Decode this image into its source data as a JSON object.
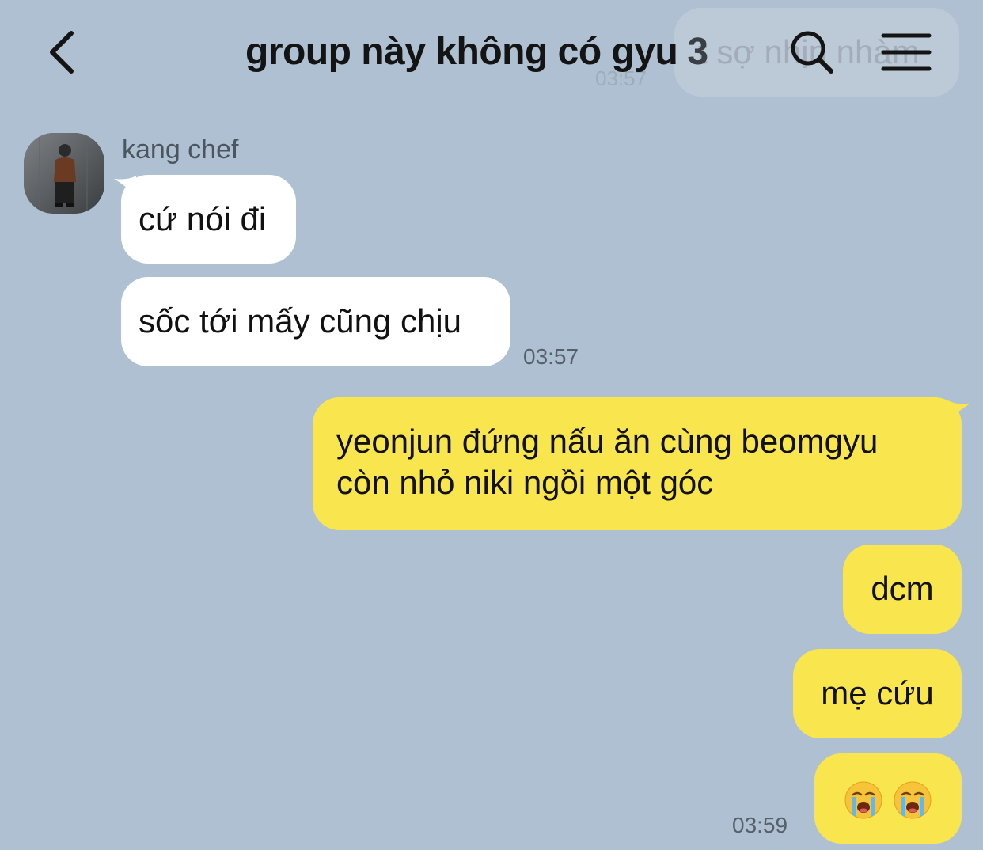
{
  "header": {
    "title": "group này không có gyu",
    "member_count": "3",
    "back_icon": "chevron-left-icon",
    "search_icon": "search-icon",
    "menu_icon": "menu-icon"
  },
  "overlay": {
    "text": "t sợ nhịn nhàm",
    "time": "03:57"
  },
  "messages": [
    {
      "direction": "incoming",
      "sender": "kang chef",
      "text": "cứ nói đi"
    },
    {
      "direction": "incoming",
      "text": "sốc tới mấy cũng chịu",
      "time": "03:57"
    },
    {
      "direction": "outgoing",
      "lines": [
        "yeonjun đứng nấu ăn cùng beomgyu",
        "còn nhỏ niki ngồi một góc"
      ]
    },
    {
      "direction": "outgoing",
      "text": "dcm"
    },
    {
      "direction": "outgoing",
      "text": "mẹ cứu"
    },
    {
      "direction": "outgoing",
      "text": "😭😭",
      "emoji_icon": "loudly-crying-face-icon",
      "time": "03:59"
    }
  ],
  "colors": {
    "background": "#aec0d1",
    "incoming_bubble": "#ffffff",
    "outgoing_bubble": "#f9e54d"
  }
}
